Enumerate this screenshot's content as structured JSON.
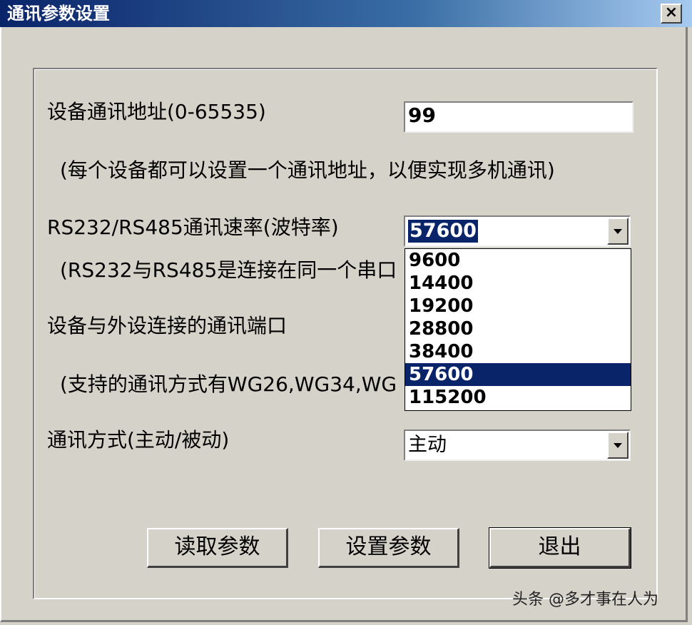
{
  "window": {
    "title": "通讯参数设置",
    "close_label": "×"
  },
  "address": {
    "label": "设备通讯地址(0-65535)",
    "value": "99",
    "hint": "(每个设备都可以设置一个通讯地址，以便实现多机通讯)"
  },
  "baud": {
    "label": "RS232/RS485通讯速率(波特率)",
    "value": "57600",
    "hint": "(RS232与RS485是连接在同一个串口",
    "options": [
      "9600",
      "14400",
      "19200",
      "28800",
      "38400",
      "57600",
      "115200"
    ]
  },
  "port": {
    "label": "设备与外设连接的通讯端口",
    "hint": "(支持的通讯方式有WG26,WG34,WG"
  },
  "mode": {
    "label": "通讯方式(主动/被动)",
    "value": "主动"
  },
  "buttons": {
    "read": "读取参数",
    "set": "设置参数",
    "exit": "退出"
  },
  "watermark": "头条 @多才事在人为"
}
